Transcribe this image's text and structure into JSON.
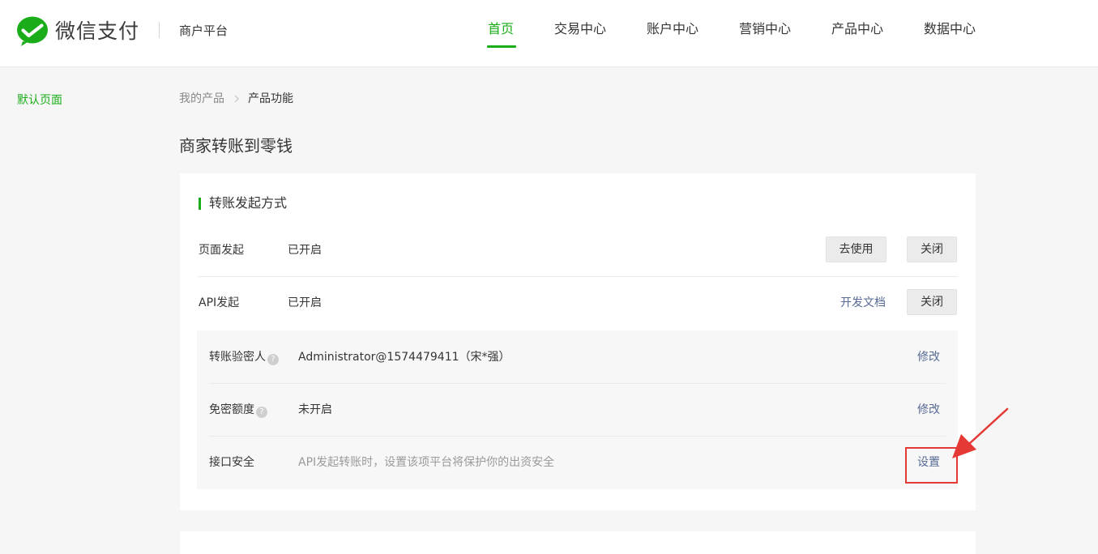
{
  "header": {
    "logo_text": "微信支付",
    "platform": "商户平台",
    "nav": [
      {
        "label": "首页",
        "active": true
      },
      {
        "label": "交易中心",
        "active": false
      },
      {
        "label": "账户中心",
        "active": false
      },
      {
        "label": "营销中心",
        "active": false
      },
      {
        "label": "产品中心",
        "active": false
      },
      {
        "label": "数据中心",
        "active": false
      }
    ]
  },
  "sidebar": {
    "items": [
      {
        "label": "默认页面"
      }
    ]
  },
  "breadcrumb": {
    "items": [
      {
        "label": "我的产品"
      },
      {
        "label": "产品功能"
      }
    ]
  },
  "page": {
    "title": "商家转账到零钱"
  },
  "section": {
    "title": "转账发起方式",
    "rows": [
      {
        "label": "页面发起",
        "status": "已开启",
        "use_button": "去使用",
        "close_button": "关闭"
      },
      {
        "label": "API发起",
        "status": "已开启",
        "doc_link": "开发文档",
        "close_button": "关闭"
      }
    ],
    "sub_rows": [
      {
        "label": "转账验密人",
        "help": "?",
        "value": "Administrator@1574479411（宋*强）",
        "action": "修改"
      },
      {
        "label": "免密额度",
        "help": "?",
        "value": "未开启",
        "action": "修改"
      },
      {
        "label": "接口安全",
        "value": "API发起转账时，设置该项平台将保护你的出资安全",
        "action": "设置"
      }
    ]
  },
  "colors": {
    "brand_green": "#1aad19",
    "link_blue": "#576b95",
    "annotation_red": "#e53935"
  }
}
